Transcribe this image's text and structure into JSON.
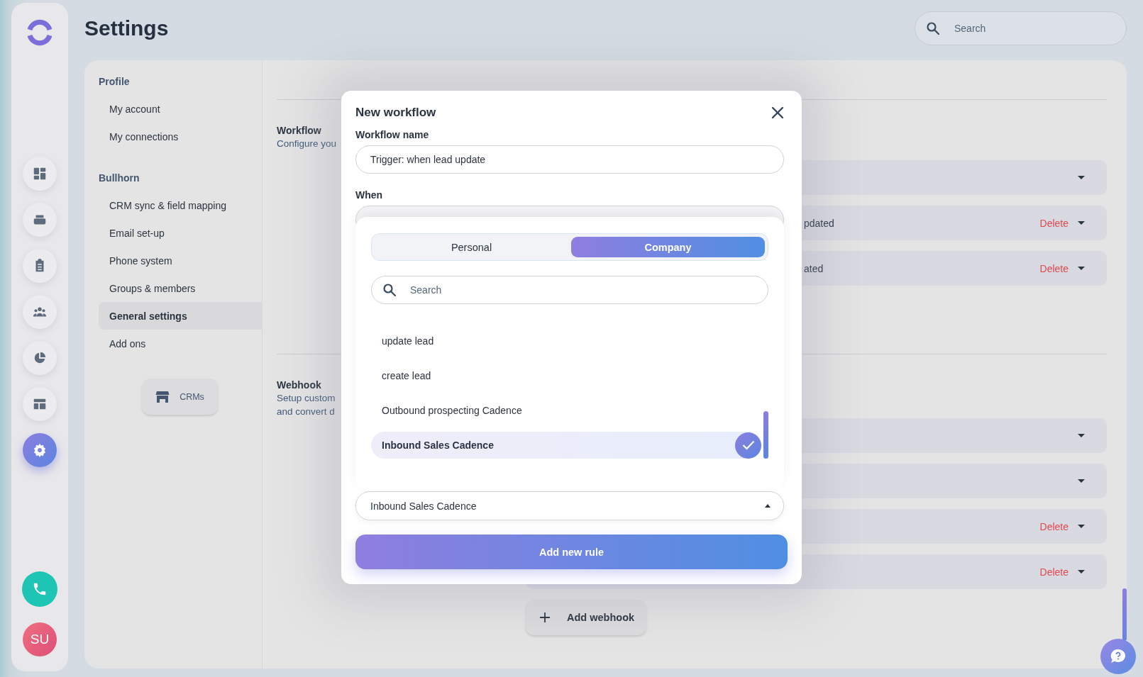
{
  "nav_rail": {
    "items": [
      {
        "kind": "dashboard",
        "selected": false
      },
      {
        "kind": "inbox",
        "selected": false
      },
      {
        "kind": "clipboard",
        "selected": false
      },
      {
        "kind": "people",
        "selected": false
      },
      {
        "kind": "pie",
        "selected": false
      },
      {
        "kind": "layout",
        "selected": false
      },
      {
        "kind": "settings",
        "selected": true
      }
    ],
    "avatar": "SU"
  },
  "header": {
    "title": "Settings",
    "search": {
      "placeholder": "Search"
    }
  },
  "settings_nav": {
    "sections": [
      {
        "title": "Profile",
        "items": [
          {
            "label": "My account",
            "selected": false
          },
          {
            "label": "My connections",
            "selected": false
          }
        ]
      },
      {
        "title": "Bullhorn",
        "items": [
          {
            "label": "CRM sync & field mapping",
            "selected": false
          },
          {
            "label": "Email set-up",
            "selected": false
          },
          {
            "label": "Phone system",
            "selected": false
          },
          {
            "label": "Groups & members",
            "selected": false
          },
          {
            "label": "General settings",
            "selected": true
          },
          {
            "label": "Add ons",
            "selected": false
          }
        ]
      }
    ],
    "crms_button": "CRMs"
  },
  "sections": [
    {
      "title": "Workflow",
      "description": [
        "Configure you"
      ],
      "rows": [
        {
          "text": null,
          "action": null
        },
        {
          "text": "pdated",
          "action": "Delete"
        },
        {
          "text": "ated",
          "action": "Delete"
        }
      ]
    },
    {
      "title": "Webhook",
      "description": [
        "Setup custom",
        "and convert d"
      ],
      "rows": [
        {
          "text": null,
          "action": null
        },
        {
          "text": null,
          "action": null
        },
        {
          "text": null,
          "action": "Delete"
        },
        {
          "text": null,
          "action": "Delete"
        }
      ],
      "add_button": "Add webhook"
    }
  ],
  "modal": {
    "title": "New workflow",
    "name_label": "Workflow name",
    "name_value": "Trigger: when lead update",
    "when_label": "When",
    "dropdown": {
      "tabs": [
        {
          "label": "Personal",
          "selected": false
        },
        {
          "label": "Company",
          "selected": true
        }
      ],
      "search_placeholder": "Search",
      "options": [
        {
          "label": "update lead",
          "selected": false
        },
        {
          "label": "create lead",
          "selected": false
        },
        {
          "label": "Outbound prospecting Cadence",
          "selected": false
        },
        {
          "label": "Inbound Sales Cadence",
          "selected": true
        }
      ]
    },
    "select_value": "Inbound Sales Cadence",
    "submit": "Add new rule"
  }
}
